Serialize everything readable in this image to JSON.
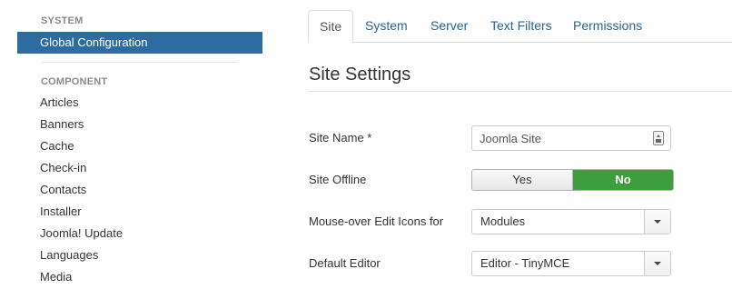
{
  "sidebar": {
    "system_heading": "SYSTEM",
    "active_item": "Global Configuration",
    "component_heading": "COMPONENT",
    "items": [
      "Articles",
      "Banners",
      "Cache",
      "Check-in",
      "Contacts",
      "Installer",
      "Joomla! Update",
      "Languages",
      "Media"
    ]
  },
  "tabs": [
    "Site",
    "System",
    "Server",
    "Text Filters",
    "Permissions"
  ],
  "active_tab": "Site",
  "section_title": "Site Settings",
  "fields": {
    "site_name": {
      "label": "Site Name *",
      "value": "Joomla Site"
    },
    "site_offline": {
      "label": "Site Offline",
      "yes": "Yes",
      "no": "No",
      "selected": "No"
    },
    "mouseover_edit_icons": {
      "label": "Mouse-over Edit Icons for",
      "value": "Modules"
    },
    "default_editor": {
      "label": "Default Editor",
      "value": "Editor - TinyMCE"
    }
  },
  "colors": {
    "active_nav_bg": "#2d6ca2",
    "toggle_selected_bg": "#3c9f3c",
    "tab_link": "#2a6496"
  },
  "icons": {
    "site_name_field": "field-info-icon",
    "select_arrow": "caret-down-icon"
  }
}
